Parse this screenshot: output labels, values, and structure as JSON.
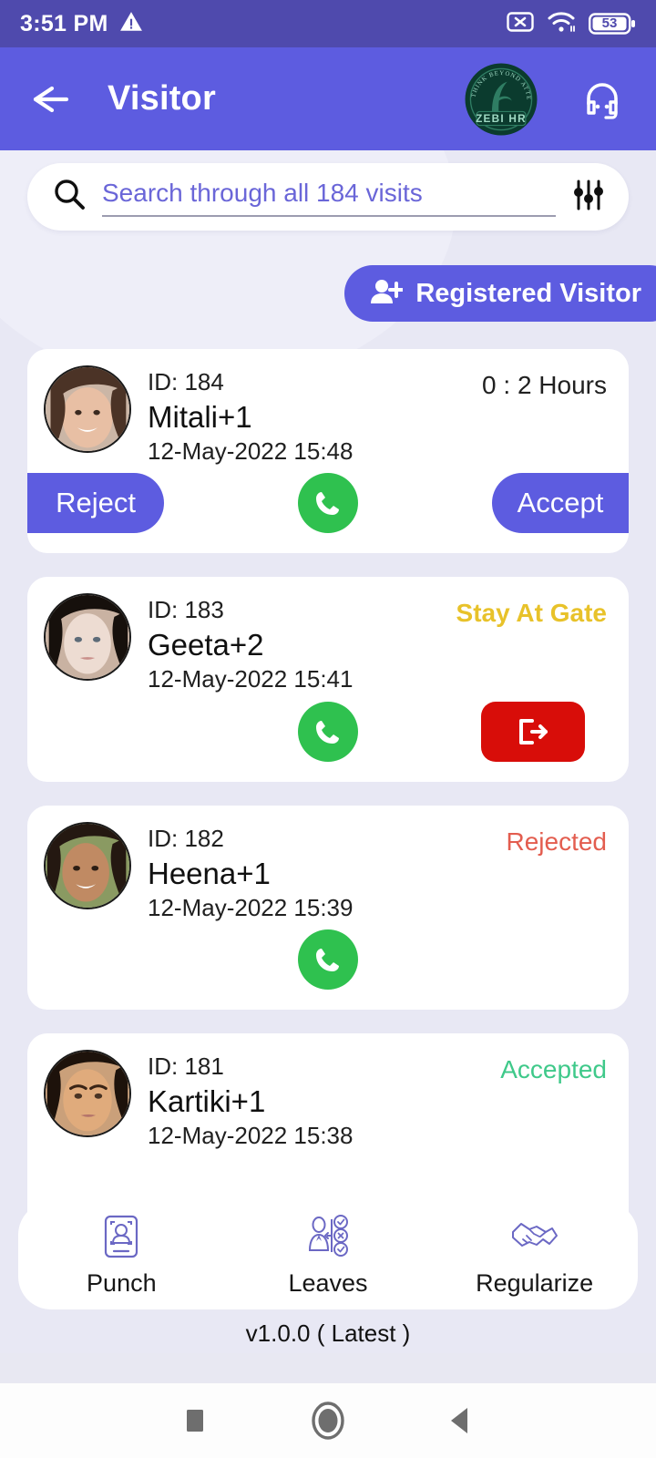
{
  "statusbar": {
    "time": "3:51 PM",
    "warning_icon": "warning-triangle-icon",
    "sim_icon": "no-sim-icon",
    "wifi_icon": "wifi-icon",
    "battery_icon": "battery-icon",
    "battery_level": "53"
  },
  "appbar": {
    "back_icon": "back-arrow-icon",
    "title": "Visitor",
    "logo_name": "zebi-hr-logo",
    "logo_text": "ZEBI HR",
    "logo_tagline": "THINK BEYOND ATTENDANCE",
    "support_icon": "headset-support-icon",
    "background_color": "#5d5ce0"
  },
  "search": {
    "icon": "search-icon",
    "placeholder": "Search through all 184 visits",
    "value": "",
    "filter_icon": "filter-sliders-icon"
  },
  "registered_visitor": {
    "icon": "person-add-icon",
    "label": "Registered Visitor"
  },
  "visitors": [
    {
      "id_label": "ID: 184",
      "name": "Mitali+1",
      "datetime": "12-May-2022 15:48",
      "status": "0 : 2 Hours",
      "status_type": "hours",
      "status_color": "#202020",
      "avatar_tone": "#d8a288",
      "actions": {
        "reject": "Reject",
        "accept": "Accept",
        "call_icon": "phone-call-icon"
      }
    },
    {
      "id_label": "ID: 183",
      "name": "Geeta+2",
      "datetime": "12-May-2022 15:41",
      "status": "Stay At Gate",
      "status_type": "gate",
      "status_color": "#e8c22a",
      "avatar_tone": "#e4d1c5",
      "actions": {
        "call_icon": "phone-call-icon",
        "exit_icon": "exit-gate-icon"
      }
    },
    {
      "id_label": "ID: 182",
      "name": "Heena+1",
      "datetime": "12-May-2022 15:39",
      "status": "Rejected",
      "status_type": "rejected",
      "status_color": "#e35d4f",
      "avatar_tone": "#c08a63",
      "actions": {
        "call_icon": "phone-call-icon"
      }
    },
    {
      "id_label": "ID: 181",
      "name": "Kartiki+1",
      "datetime": "12-May-2022 15:38",
      "status": "Accepted",
      "status_type": "accepted",
      "status_color": "#3fc98a",
      "avatar_tone": "#d9a271",
      "actions": {}
    }
  ],
  "bottomnav": {
    "items": [
      {
        "icon": "punch-face-scan-icon",
        "label": "Punch"
      },
      {
        "icon": "leaves-approval-icon",
        "label": "Leaves"
      },
      {
        "icon": "handshake-regularize-icon",
        "label": "Regularize"
      }
    ]
  },
  "version": "v1.0.0 ( Latest )",
  "androidnav": {
    "recents_icon": "recents-square-icon",
    "home_icon": "home-circle-icon",
    "back_icon": "back-triangle-icon"
  },
  "colors": {
    "accent": "#5d5ce0",
    "statusbar": "#4f4aad",
    "page_bg": "#e8e8f4",
    "call_green": "#2fc14f",
    "exit_red": "#d80d09"
  }
}
